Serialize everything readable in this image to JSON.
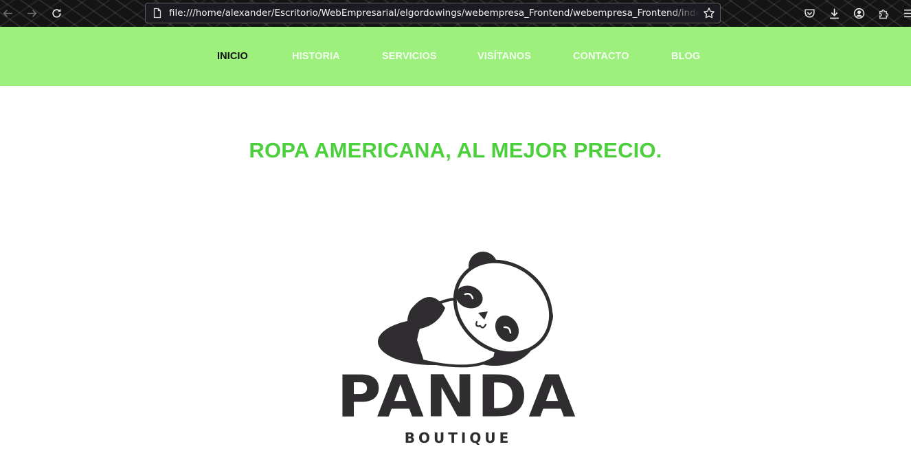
{
  "browser": {
    "url": "file:///home/alexander/Escritorio/WebEmpresarial/elgordowings/webempresa_Frontend/webempresa_Frontend/index.html"
  },
  "nav": {
    "items": [
      {
        "label": "INICIO",
        "active": true
      },
      {
        "label": "HISTORIA",
        "active": false
      },
      {
        "label": "SERVICIOS",
        "active": false
      },
      {
        "label": "VISÍTANOS",
        "active": false
      },
      {
        "label": "CONTACTO",
        "active": false
      },
      {
        "label": "BLOG",
        "active": false
      }
    ]
  },
  "hero": {
    "headline": "ROPA AMERICANA, AL MEJOR PRECIO."
  },
  "logo": {
    "name": "PANDA",
    "subtitle": "BOUTIQUE"
  },
  "colors": {
    "nav_background": "#9df07c",
    "headline": "#4ccf3c",
    "logo_dark": "#2f2d2f"
  }
}
